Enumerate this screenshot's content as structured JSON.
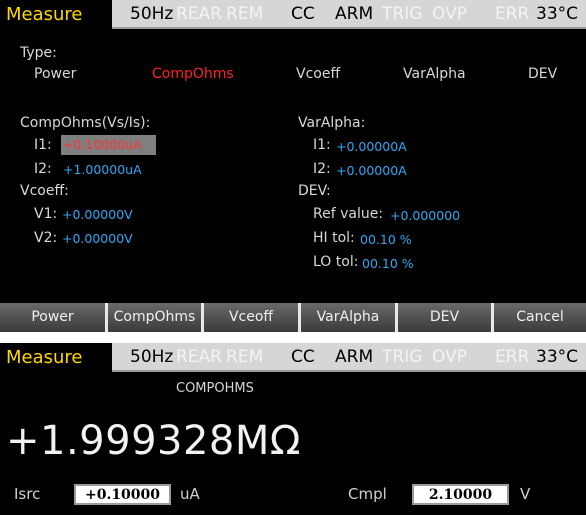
{
  "status_bar": {
    "mode": "Measure",
    "freq": "50Hz",
    "rear": "REAR",
    "rem": "REM",
    "cc": "CC",
    "arm": "ARM",
    "trig": "TRIG",
    "ovp": "OVP",
    "err": "ERR",
    "temp": "33°C"
  },
  "config": {
    "type_label": "Type:",
    "types": [
      "Power",
      "CompOhms",
      "Vcoeff",
      "VarAlpha",
      "DEV"
    ],
    "selected_type": "CompOhms",
    "compohms": {
      "header": "CompOhms(Vs/Is):",
      "i1_label": "I1:",
      "i1_value": "+0.10000uA",
      "i2_label": "I2:",
      "i2_value": "+1.00000uA"
    },
    "vcoeff": {
      "header": "Vcoeff:",
      "v1_label": "V1:",
      "v1_value": "+0.00000V",
      "v2_label": "V2:",
      "v2_value": "+0.00000V"
    },
    "varalpha": {
      "header": "VarAlpha:",
      "i1_label": "I1:",
      "i1_value": "+0.00000A",
      "i2_label": "I2:",
      "i2_value": "+0.00000A"
    },
    "dev": {
      "header": "DEV:",
      "ref_label": "Ref value:",
      "ref_value": "+0.000000",
      "hi_label": "HI tol:",
      "hi_value": "00.10 %",
      "lo_label": "LO tol:",
      "lo_value": "00.10 %"
    }
  },
  "softkeys": [
    "Power",
    "CompOhms",
    "Vceoff",
    "VarAlpha",
    "DEV",
    "Cancel"
  ],
  "measurement": {
    "function": "COMPOHMS",
    "reading": "+1.999328MΩ",
    "isrc_label": "Isrc",
    "isrc_value": "+0.10000",
    "isrc_unit": "uA",
    "cmpl_label": "Cmpl",
    "cmpl_value": "2.10000",
    "cmpl_unit": "V"
  },
  "colors": {
    "mode_text": "#ffd800",
    "value_text": "#2fa8f0",
    "selected_text": "#ff2222",
    "statusbar_bg": "#d6d6d6",
    "screen_bg": "#000000"
  }
}
